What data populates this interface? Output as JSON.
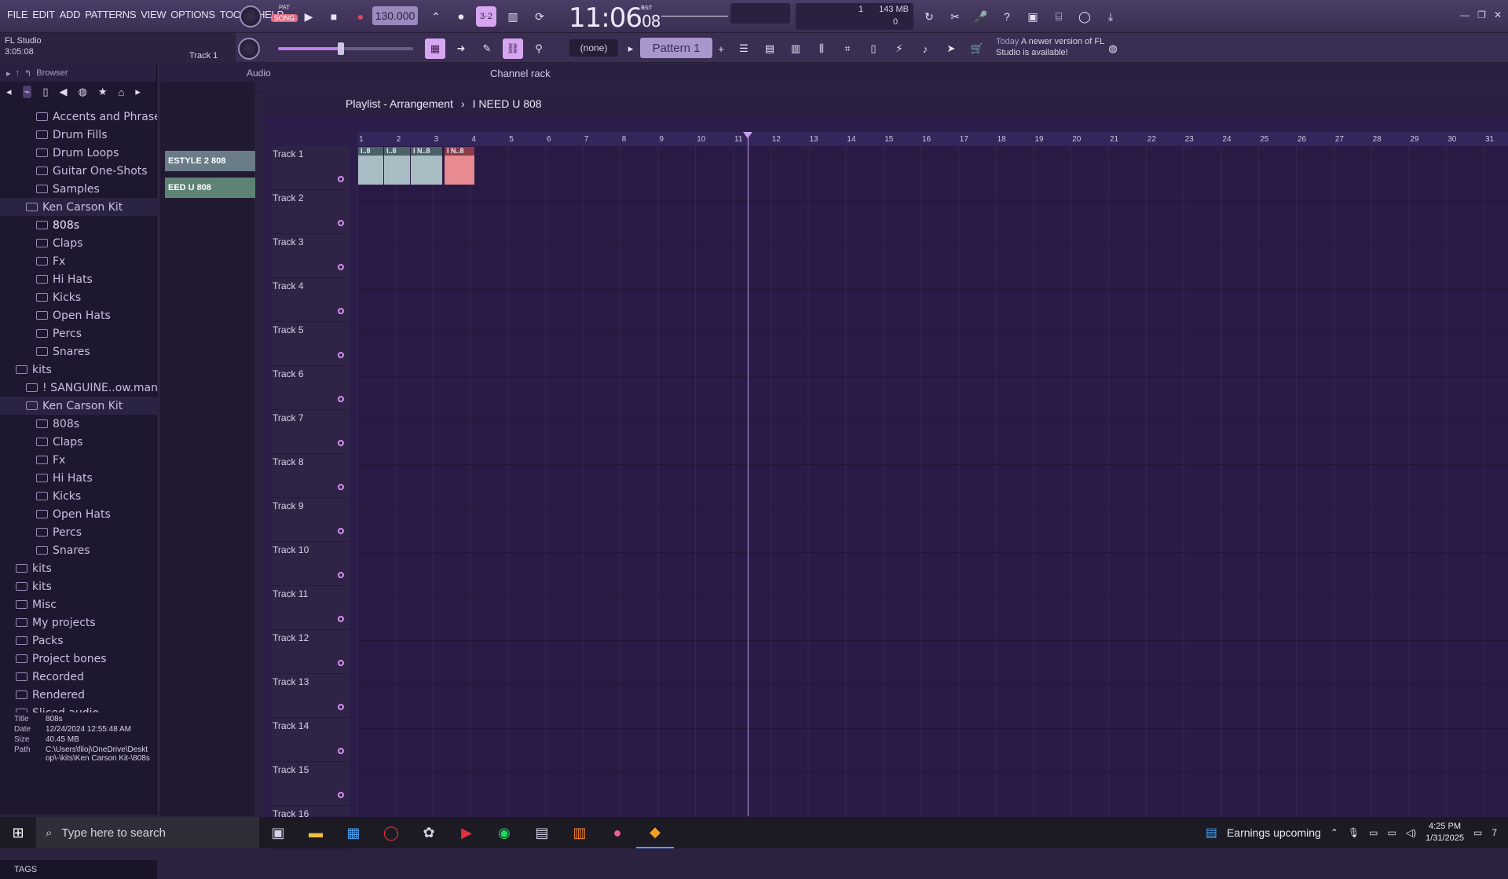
{
  "menu": [
    "FILE",
    "EDIT",
    "ADD",
    "PATTERNS",
    "VIEW",
    "OPTIONS",
    "TOOLS",
    "HELP"
  ],
  "transport": {
    "pat_label": "PAT",
    "song_label": "SONG",
    "tempo": "130.000"
  },
  "clock": {
    "main": "11:06",
    "frac": "08",
    "unit": "B:S:T"
  },
  "cpu": {
    "voices": "1",
    "memory": "143 MB",
    "polyphony": "0"
  },
  "hint": {
    "app": "FL Studio",
    "time": "3:05:08",
    "track": "Track 1"
  },
  "snap": "(none)",
  "pattern": "Pattern 1",
  "news": {
    "today": "Today",
    "message": "A newer version of FL Studio is available!"
  },
  "browser": {
    "title": "Browser",
    "tree": [
      {
        "label": "Accents and Phrases",
        "level": 2
      },
      {
        "label": "Drum Fills",
        "level": 2
      },
      {
        "label": "Drum Loops",
        "level": 2
      },
      {
        "label": "Guitar One-Shots",
        "level": 2
      },
      {
        "label": "Samples",
        "level": 2
      },
      {
        "label": "Ken Carson Kit",
        "level": 1,
        "sel": true
      },
      {
        "label": "808s",
        "level": 2,
        "bold": true
      },
      {
        "label": "Claps",
        "level": 2
      },
      {
        "label": "Fx",
        "level": 2
      },
      {
        "label": "Hi Hats",
        "level": 2
      },
      {
        "label": "Kicks",
        "level": 2
      },
      {
        "label": "Open Hats",
        "level": 2
      },
      {
        "label": "Percs",
        "level": 2
      },
      {
        "label": "Snares",
        "level": 2
      },
      {
        "label": "kits",
        "level": 0
      },
      {
        "label": "! SANGUINE..ow.manifest)",
        "level": 1
      },
      {
        "label": "Ken Carson Kit",
        "level": 1,
        "sel": true
      },
      {
        "label": "808s",
        "level": 2
      },
      {
        "label": "Claps",
        "level": 2
      },
      {
        "label": "Fx",
        "level": 2
      },
      {
        "label": "Hi Hats",
        "level": 2
      },
      {
        "label": "Kicks",
        "level": 2
      },
      {
        "label": "Open Hats",
        "level": 2
      },
      {
        "label": "Percs",
        "level": 2
      },
      {
        "label": "Snares",
        "level": 2
      },
      {
        "label": "kits",
        "level": 0
      },
      {
        "label": "kits",
        "level": 0
      },
      {
        "label": "Misc",
        "level": 0
      },
      {
        "label": "My projects",
        "level": 0
      },
      {
        "label": "Packs",
        "level": 0
      },
      {
        "label": "Project bones",
        "level": 0
      },
      {
        "label": "Recorded",
        "level": 0
      },
      {
        "label": "Rendered",
        "level": 0
      },
      {
        "label": "Sliced audio",
        "level": 0
      }
    ],
    "info": {
      "title_k": "Title",
      "title_v": "808s",
      "date_k": "Date",
      "date_v": "12/24/2024 12:55:48 AM",
      "size_k": "Size",
      "size_v": "40.45 MB",
      "path_k": "Path",
      "path_v": "C:\\Users\\filoj\\OneDrive\\Desktop\\-\\kits\\Ken Carson Kit-\\808s"
    },
    "tags": "TAGS"
  },
  "channel": {
    "audio": "Audio",
    "rack": "Channel rack"
  },
  "picker": [
    "ESTYLE 2 808",
    "EED U 808"
  ],
  "playlist": {
    "title": "Playlist - Arrangement",
    "sep": "›",
    "pattern": "I NEED U 808",
    "ruler": [
      "1",
      "2",
      "3",
      "4",
      "5",
      "6",
      "7",
      "8",
      "9",
      "10",
      "11",
      "12",
      "13",
      "14",
      "15",
      "16",
      "17",
      "18",
      "19",
      "20",
      "21",
      "22",
      "23",
      "24",
      "25",
      "26",
      "27",
      "28",
      "29",
      "30",
      "31"
    ],
    "tracks": [
      "Track 1",
      "Track 2",
      "Track 3",
      "Track 4",
      "Track 5",
      "Track 6",
      "Track 7",
      "Track 8",
      "Track 9",
      "Track 10",
      "Track 11",
      "Track 12",
      "Track 13",
      "Track 14",
      "Track 15",
      "Track 16"
    ],
    "clips": [
      {
        "label": "I..8",
        "kind": "normal"
      },
      {
        "label": "I..8",
        "kind": "normal"
      },
      {
        "label": "I N..8",
        "kind": "normal"
      },
      {
        "label": "I N..8",
        "kind": "red"
      }
    ]
  },
  "taskbar": {
    "search_placeholder": "Type here to search",
    "weather": "Earnings upcoming",
    "time": "4:25 PM",
    "date": "1/31/2025",
    "notif_count": "7"
  },
  "colors": {
    "accent": "#d6a6f0",
    "bg": "#32205a",
    "clip": "#a9bcc4",
    "clip_red": "#e88a92"
  }
}
